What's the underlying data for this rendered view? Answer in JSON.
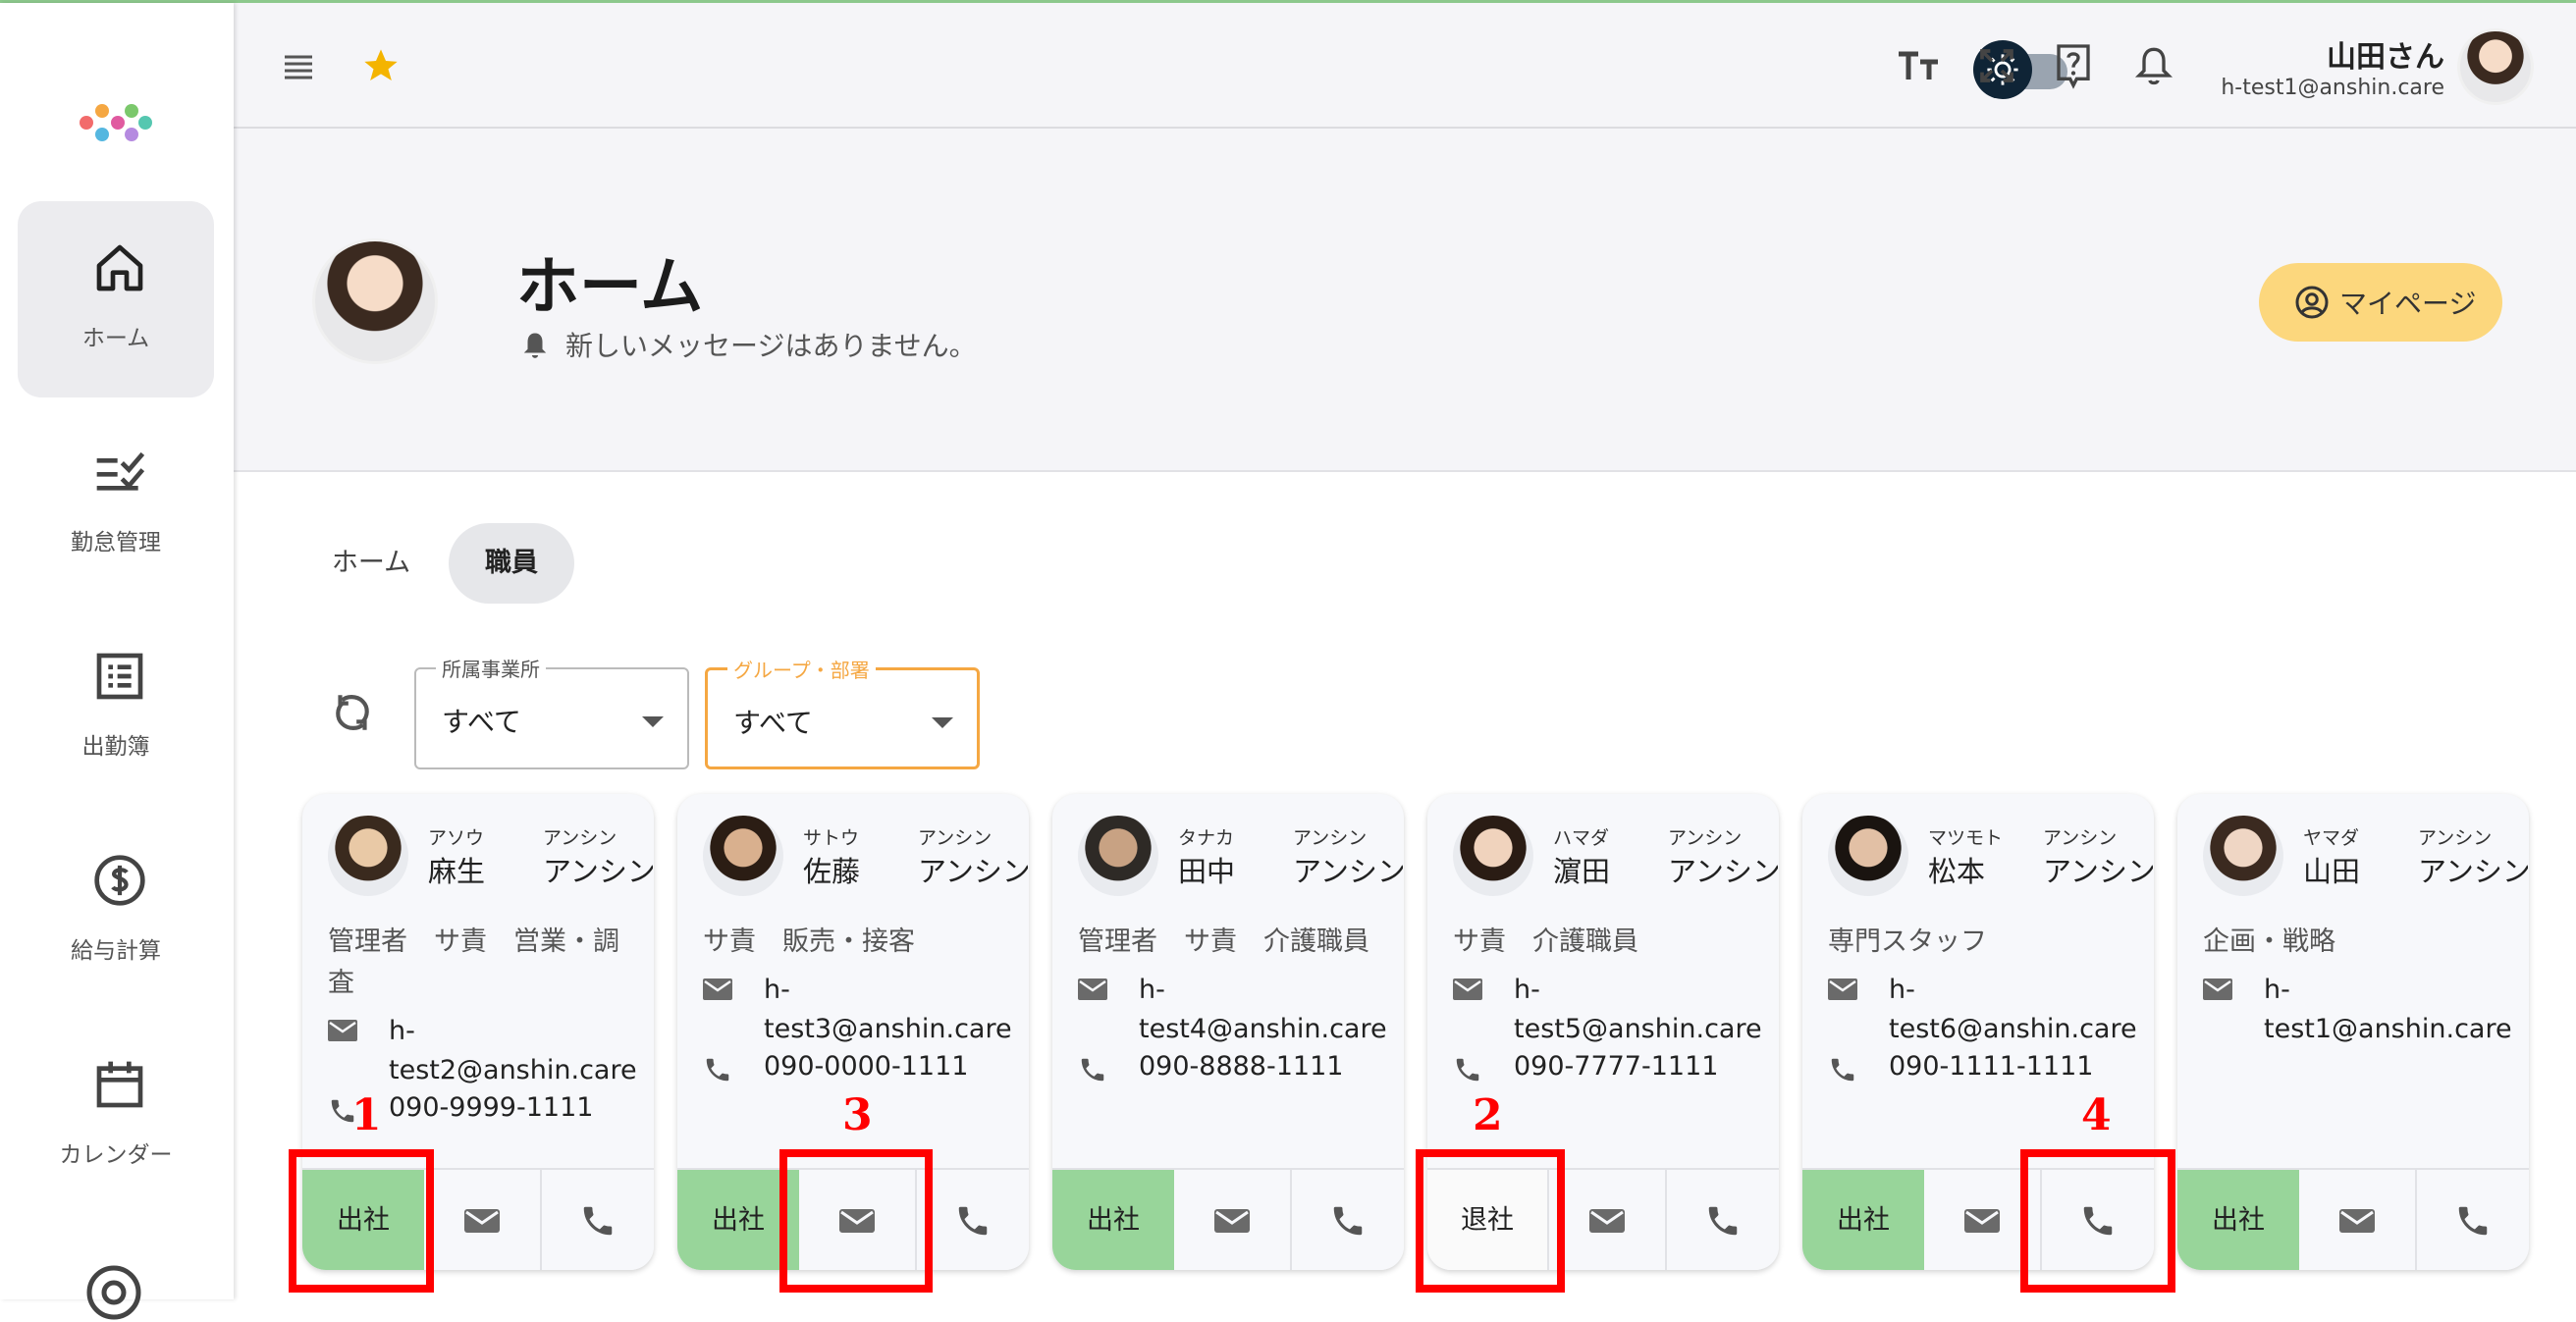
{
  "colors": {
    "accent_green": "#98d59a",
    "mypage_button": "#fcd77d",
    "focus_orange": "#f5a742",
    "highlight_red": "#ff0000"
  },
  "sidebar": {
    "items": [
      {
        "label": "ホーム",
        "icon": "home-icon",
        "active": true
      },
      {
        "label": "勤怠管理",
        "icon": "checklist-icon"
      },
      {
        "label": "出勤簿",
        "icon": "list-icon"
      },
      {
        "label": "給与計算",
        "icon": "dollar-icon"
      },
      {
        "label": "カレンダー",
        "icon": "calendar-icon"
      }
    ]
  },
  "header": {
    "user_name": "山田さん",
    "user_email": "h-test1@anshin.care",
    "icons": [
      "menu-icon",
      "star-icon",
      "theme-toggle",
      "font-size-icon",
      "fullscreen-icon",
      "help-icon",
      "bell-icon"
    ]
  },
  "hero": {
    "title": "ホーム",
    "message": "新しいメッセージはありません。",
    "mypage_label": "マイページ"
  },
  "tabs": [
    {
      "label": "ホーム"
    },
    {
      "label": "職員",
      "active": true
    }
  ],
  "filters": {
    "office": {
      "label": "所属事業所",
      "value": "すべて"
    },
    "group": {
      "label": "グループ・部署",
      "value": "すべて"
    }
  },
  "staff": [
    {
      "kana1": "アソウ",
      "name1": "麻生",
      "kana2": "アンシン",
      "name2": "アンシン",
      "roles": "管理者　サ責　営業・調査",
      "email_pre": "h-",
      "email_post": "test2@anshin.care",
      "phone": "090-9999-1111",
      "attendance": "出社",
      "status": "in"
    },
    {
      "kana1": "サトウ",
      "name1": "佐藤",
      "kana2": "アンシン",
      "name2": "アンシン",
      "roles": "サ責　販売・接客",
      "email_pre": "h-",
      "email_post": "test3@anshin.care",
      "phone": "090-0000-1111",
      "attendance": "出社",
      "status": "in"
    },
    {
      "kana1": "タナカ",
      "name1": "田中",
      "kana2": "アンシン",
      "name2": "アンシン",
      "roles": "管理者　サ責　介護職員",
      "email_pre": "h-",
      "email_post": "test4@anshin.care",
      "phone": "090-8888-1111",
      "attendance": "出社",
      "status": "in"
    },
    {
      "kana1": "ハマダ",
      "name1": "濵田",
      "kana2": "アンシン",
      "name2": "アンシン",
      "roles": "サ責　介護職員",
      "email_pre": "h-",
      "email_post": "test5@anshin.care",
      "phone": "090-7777-1111",
      "attendance": "退社",
      "status": "out"
    },
    {
      "kana1": "マツモト",
      "name1": "松本",
      "kana2": "アンシン",
      "name2": "アンシン",
      "roles": "専門スタッフ",
      "email_pre": "h-",
      "email_post": "test6@anshin.care",
      "phone": "090-1111-1111",
      "attendance": "出社",
      "status": "in"
    },
    {
      "kana1": "ヤマダ",
      "name1": "山田",
      "kana2": "アンシン",
      "name2": "アンシン",
      "roles": "企画・戦略",
      "email_pre": "h-",
      "email_post": "test1@anshin.care",
      "phone": "",
      "attendance": "出社",
      "status": "in"
    }
  ],
  "annotations": [
    "1",
    "2",
    "3",
    "4"
  ]
}
